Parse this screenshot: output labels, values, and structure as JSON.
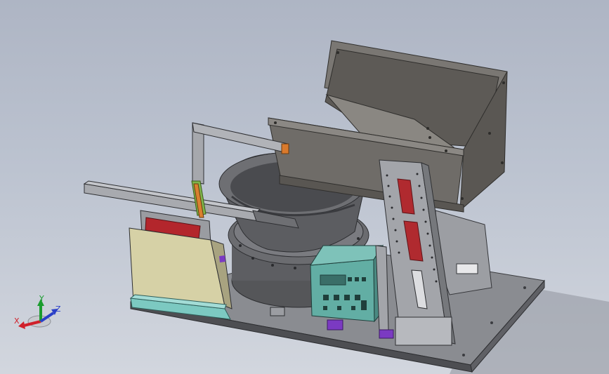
{
  "viewport": {
    "background_top": "#aeb5c4",
    "background_bottom": "#d2d6de"
  },
  "model": {
    "base_plate_color": "#84868b",
    "hopper_color": "#6d6a66",
    "bowl_color": "#5b5c5f",
    "frame_color": "#a9abb0",
    "panel_color": "#d8d3a8",
    "accent_red": "#b0242a",
    "accent_purple": "#6a2bb5",
    "teal_base": "#7dc7c0",
    "controller_color": "#5aa89f"
  },
  "triad": {
    "x_label": "X",
    "y_label": "Y",
    "z_label": "Z",
    "x_color": "#d0202a",
    "y_color": "#1a9c2e",
    "z_color": "#2a3fc8"
  }
}
